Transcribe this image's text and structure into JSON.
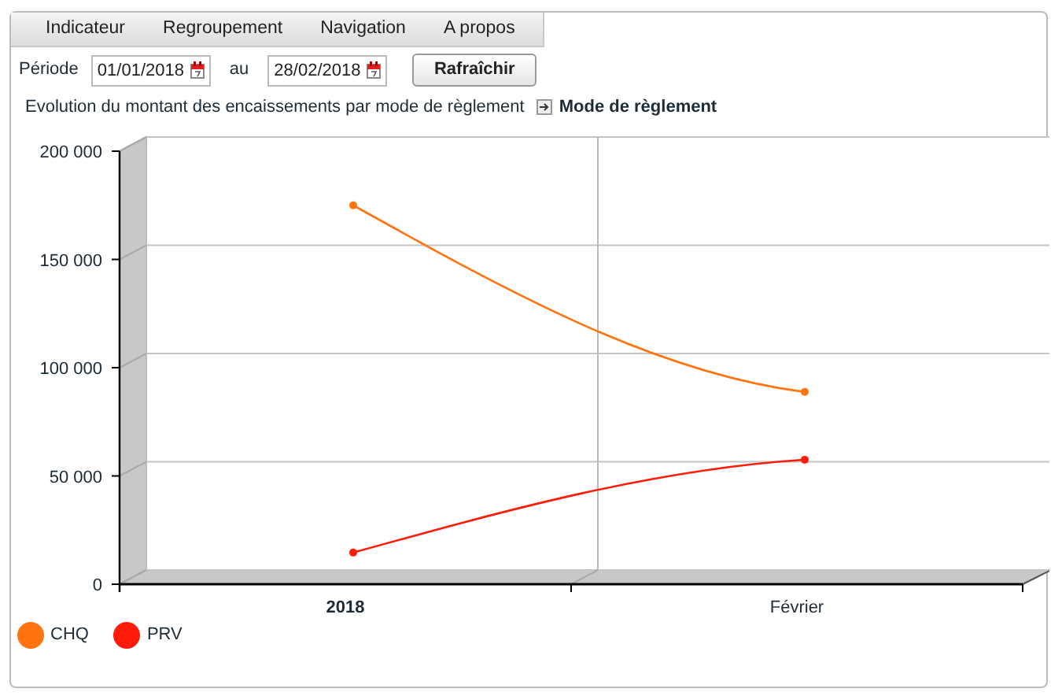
{
  "menu": [
    {
      "label": "Indicateur"
    },
    {
      "label": "Regroupement"
    },
    {
      "label": "Navigation"
    },
    {
      "label": "A propos"
    }
  ],
  "period": {
    "label": "Période",
    "from": "01/01/2018",
    "separator": "au",
    "to": "28/02/2018",
    "button": "Rafraîchir"
  },
  "chart": {
    "title": "Evolution du montant des encaissements par mode de règlement",
    "dimension": "Mode de règlement",
    "chart_data": {
      "type": "line",
      "categories": [
        "2018",
        "Février"
      ],
      "ylim": [
        0,
        200000
      ],
      "yticks": [
        {
          "value": 0,
          "label": "0"
        },
        {
          "value": 50000,
          "label": "50 000"
        },
        {
          "value": 100000,
          "label": "100 000"
        },
        {
          "value": 150000,
          "label": "150 000"
        },
        {
          "value": 200000,
          "label": "200 000"
        }
      ],
      "series": [
        {
          "name": "CHQ",
          "color": "#ff7410",
          "marker": "circle",
          "values": [
            175000,
            88800
          ]
        },
        {
          "name": "PRV",
          "color": "#ff1a0a",
          "marker": "circle",
          "values": [
            14600,
            57500
          ]
        }
      ]
    }
  }
}
